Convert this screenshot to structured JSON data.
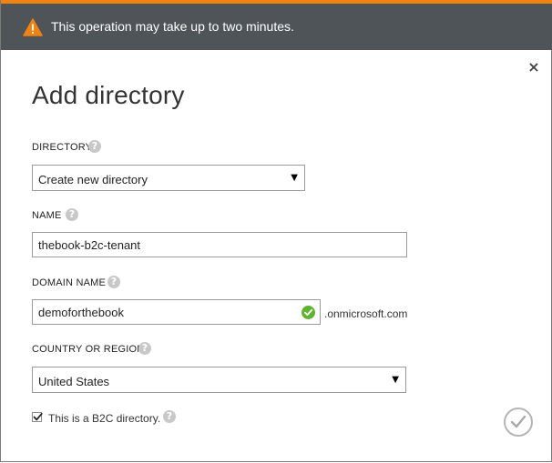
{
  "warning": {
    "text": "This operation may take up to two minutes.",
    "icon": "warning-triangle-icon",
    "accent_color": "#f0830f",
    "bar_color": "#4f5459"
  },
  "dialog": {
    "title": "Add directory",
    "close_icon": "×"
  },
  "fields": {
    "directory": {
      "label": "DIRECTORY",
      "value": "Create new directory"
    },
    "name": {
      "label": "NAME",
      "value": "thebook-b2c-tenant"
    },
    "domain": {
      "label": "DOMAIN NAME",
      "value": "demoforthebook",
      "suffix": ".onmicrosoft.com",
      "status": "valid"
    },
    "country": {
      "label": "COUNTRY OR REGION",
      "value": "United States"
    },
    "b2c": {
      "label": "This is a B2C directory.",
      "checked": true
    }
  },
  "help_glyph": "?",
  "dropdown_glyph": "▼"
}
